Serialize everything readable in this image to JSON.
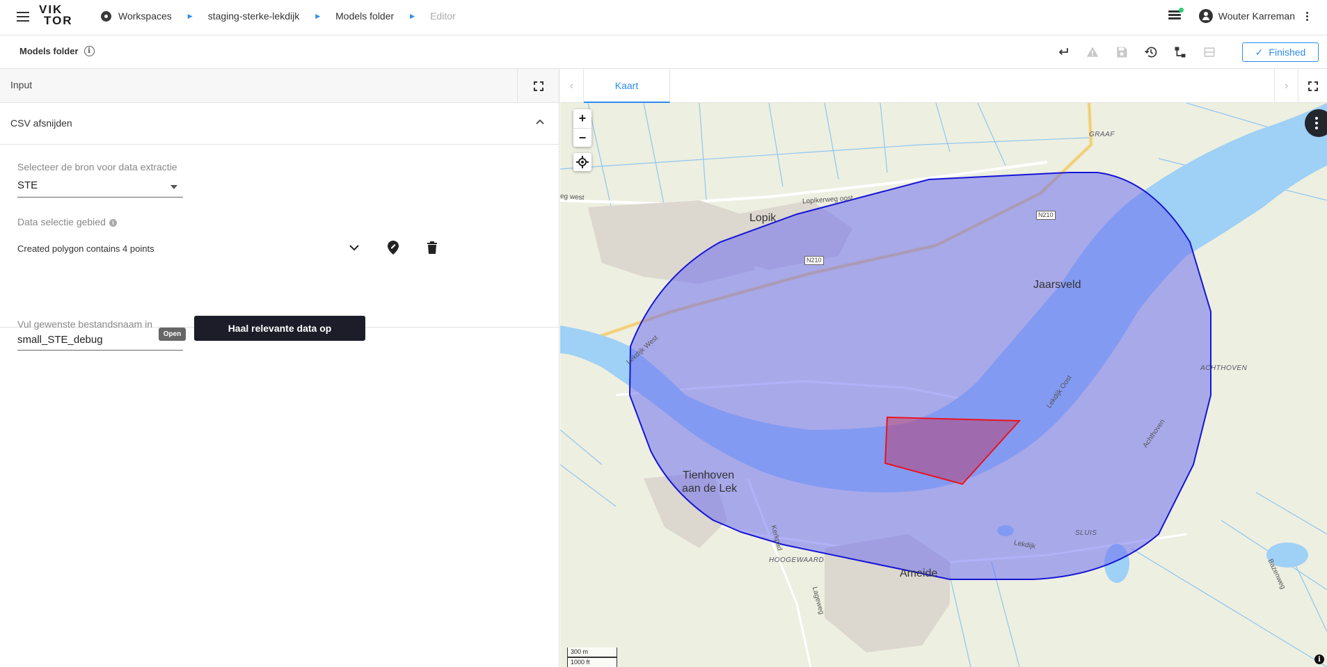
{
  "topbar": {
    "logo_line1": "VIK",
    "logo_line2": "TOR",
    "breadcrumbs": [
      "Workspaces",
      "staging-sterke-lekdijk",
      "Models folder",
      "Editor"
    ],
    "user_name": "Wouter Karreman"
  },
  "subbar": {
    "title": "Models folder",
    "finished_label": "Finished"
  },
  "left": {
    "header_label": "Input",
    "section_title": "CSV afsnijden",
    "source_label": "Selecteer de bron voor data extractie",
    "source_value": "STE",
    "area_label": "Data selectie gebied",
    "polygon_text": "Created polygon contains 4 points",
    "filename_label": "Vul gewenste bestandsnaam in",
    "filename_value": "small_STE_debug",
    "open_badge": "Open",
    "fetch_button": "Haal relevante data op"
  },
  "right": {
    "tab_label": "Kaart",
    "map": {
      "zoom_in": "+",
      "zoom_out": "−",
      "places": [
        "Lopik",
        "Jaarsveld",
        "Tienhoven",
        "aan de Lek",
        "Ameide"
      ],
      "roads": [
        "Lopikerweg oost",
        "Lekdijk West",
        "Lekdijk Oost",
        "Lekdijk",
        "Kerkpad",
        "Lageweg",
        "Achthoven",
        "Bazenweg",
        "eg west"
      ],
      "areas": [
        "GRAAF",
        "ACHTHOVEN",
        "SLUIS",
        "HOOGEWAARD"
      ],
      "shields": [
        "N210",
        "N210"
      ],
      "scale_m": "300 m",
      "scale_ft": "1000 ft",
      "attribution": "i"
    },
    "colors": {
      "selection_fill": "#6a6af0",
      "selection_stroke": "#1515d6",
      "polygon_stroke": "#e8141e",
      "water": "#9fd0f5"
    }
  }
}
